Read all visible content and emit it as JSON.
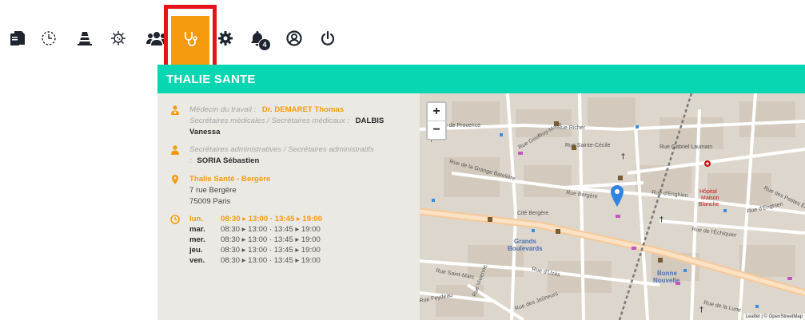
{
  "toolbar": {
    "items": [
      {
        "icon": "documents-icon"
      },
      {
        "icon": "clock-icon"
      },
      {
        "icon": "traffic-cone-icon"
      },
      {
        "icon": "virus-icon"
      },
      {
        "icon": "users-icon"
      },
      {
        "icon": "stethoscope-icon",
        "active": true
      },
      {
        "icon": "gear-icon"
      },
      {
        "icon": "bell-icon",
        "badge": "4"
      },
      {
        "icon": "user-circle-icon"
      },
      {
        "icon": "power-icon"
      }
    ],
    "notification_count": "4"
  },
  "colors": {
    "accent": "#f59a0c",
    "header": "#07d6b2",
    "highlight_border": "#e4141b",
    "panel_bg": "#eae9e4"
  },
  "header": {
    "title": "THALIE SANTE"
  },
  "info": {
    "doctor_label": "Médecin du travail :",
    "doctor_name": "Dr. DEMARET Thomas",
    "medical_secretaries_label": "Secrétaires médicales / Secrétaires médicaux :",
    "medical_secretary_name_1": "DALBIS",
    "medical_secretary_name_2": "Vanessa",
    "admin_secretaries_label": "Secrétaires administratives / Secrétaires administratifs",
    "admin_colon": ":",
    "admin_secretary_name": "SORIA Sébastien",
    "location_name": "Thalie Santé - Bergère",
    "address_line1": "7 rue Bergère",
    "address_line2": "75009 Paris"
  },
  "hours": [
    {
      "day": "lun.",
      "value": "08:30 ▸ 13:00  ·  13:45 ▸ 19:00",
      "today": true
    },
    {
      "day": "mar.",
      "value": "08:30 ▸ 13:00  ·  13:45 ▸ 19:00"
    },
    {
      "day": "mer.",
      "value": "08:30 ▸ 13:00  ·  13:45 ▸ 19:00"
    },
    {
      "day": "jeu.",
      "value": "08:30 ▸ 13:00  ·  13:45 ▸ 19:00"
    },
    {
      "day": "ven.",
      "value": "08:30 ▸ 13:00  ·  13:45 ▸ 19:00"
    }
  ],
  "map": {
    "zoom_in": "+",
    "zoom_out": "−",
    "labels": {
      "rue_de_provence": "Rue de Provence",
      "rue_richer": "Rue Richer",
      "rue_geoffroy_marie": "Rue Geoffroy-Marie",
      "rue_de_la_grange_bateliere": "Rue de la Grange Batelière",
      "rue_sainte_cecile": "Rue Sainte-Cécile",
      "rue_gabriel_laumain": "Rue Gabriel Laumain",
      "rue_bergere": "Rue Bergère",
      "rue_d_enghien": "Rue d'Enghien",
      "hopital_1": "Hôpital",
      "hopital_2": "Maison",
      "hopital_3": "Blanche",
      "rue_des_petites_ecuries": "Rue des Petites Écuries",
      "cite_bergere": "Cité Bergère",
      "grands_boulevards_1": "Grands",
      "grands_boulevards_2": "Boulevards",
      "rue_de_l_echiquier": "Rue de l'Échiquier",
      "rue_d_enghien_2": "Rue d'Enghien",
      "bonne_nouvelle_1": "Bonne",
      "bonne_nouvelle_2": "Nouvelle",
      "rue_saint_marc": "Rue Saint-Marc",
      "rue_feydeau": "Rue Feydeau",
      "rue_des_jeuneurs": "Rue des Jeûneurs",
      "rue_de_la_lune": "Rue de la Lune",
      "rue_d_uzes": "Rue d'Uzès",
      "rue_vivienne": "Rue Vivienne"
    },
    "attribution": "Leaflet | © OpenStreetMap"
  }
}
